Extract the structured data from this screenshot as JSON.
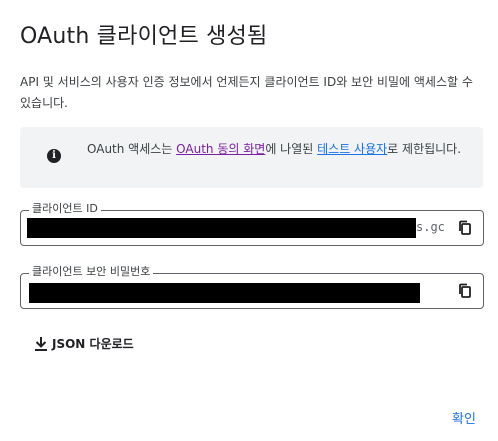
{
  "dialog": {
    "title": "OAuth 클라이언트 생성됨",
    "description": "API 및 서비스의 사용자 인증 정보에서 언제든지 클라이언트 ID와 보안 비밀에 액세스할 수 있습니다."
  },
  "info": {
    "text_before": "OAuth 액세스는 ",
    "link_consent": "OAuth 동의 화면",
    "text_middle": "에 나열된 ",
    "link_test_users": "테스트 사용자",
    "text_after": "로 제한됩니다.",
    "icon": "info-icon",
    "colors": {
      "consent_link": "#7b1fa2",
      "test_users_link": "#1a73e8"
    }
  },
  "client_id": {
    "label": "클라이언트 ID",
    "visible_tail": "s.gc",
    "copy_icon": "copy-icon"
  },
  "client_secret": {
    "label": "클라이언트 보안 비밀번호",
    "copy_icon": "copy-icon"
  },
  "download": {
    "label": "JSON 다운로드",
    "icon": "download-icon"
  },
  "actions": {
    "confirm_label": "확인",
    "accent_color": "#1a73e8"
  }
}
